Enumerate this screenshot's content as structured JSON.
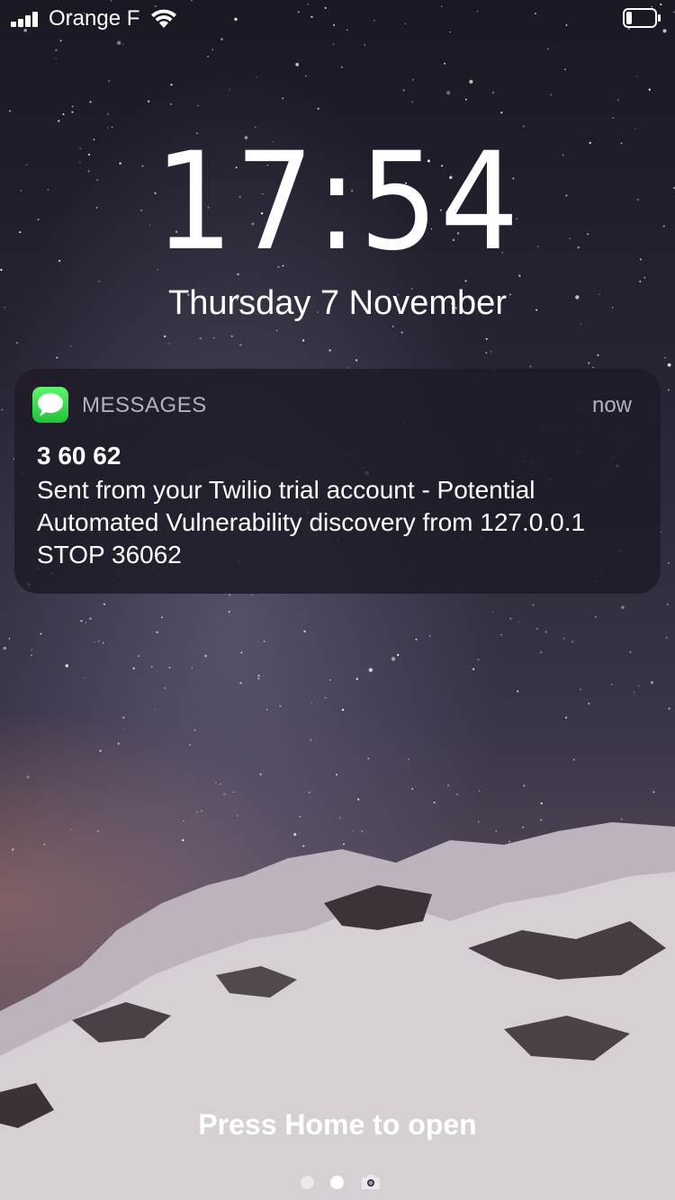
{
  "status_bar": {
    "carrier": "Orange F",
    "signal_bars": 4,
    "battery_level": 0.2
  },
  "lock_screen": {
    "time": "17:54",
    "date": "Thursday 7 November",
    "hint": "Press Home to open"
  },
  "notification": {
    "app_name": "MESSAGES",
    "time": "now",
    "sender": "3 60 62",
    "message": "Sent from your Twilio trial account - Potential Automated Vulnerability discovery from 127.0.0.1 STOP 36062",
    "app_icon": "messages-app-icon"
  },
  "pager": {
    "pages": 2,
    "current": 2,
    "camera_icon": "camera-icon"
  },
  "colors": {
    "messages_green": "#34c759",
    "notification_bg": "#1e1b28"
  }
}
